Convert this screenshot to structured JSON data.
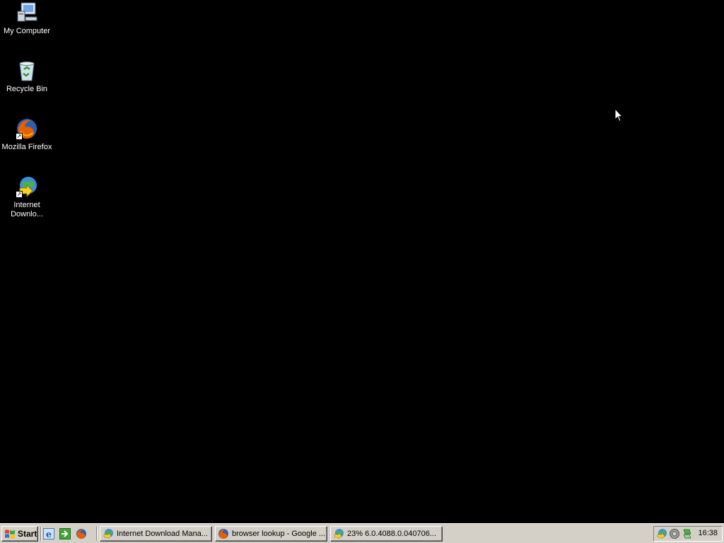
{
  "desktop": {
    "icons": [
      {
        "label": "My Computer",
        "icon": "my-computer-icon"
      },
      {
        "label": "Recycle Bin",
        "icon": "recycle-bin-icon"
      },
      {
        "label": "Mozilla Firefox",
        "icon": "firefox-icon"
      },
      {
        "label": "Internet Downlo...",
        "icon": "internet-download-manager-icon"
      }
    ],
    "background_color": "#000000"
  },
  "taskbar": {
    "start_label": "Start",
    "quick_launch": [
      {
        "icon": "internet-explorer-icon"
      },
      {
        "icon": "show-desktop-icon"
      },
      {
        "icon": "firefox-icon"
      }
    ],
    "tasks": [
      {
        "label": "Internet Download Mana...",
        "icon": "internet-download-manager-icon"
      },
      {
        "label": "browser lookup - Google ...",
        "icon": "firefox-icon"
      },
      {
        "label": "23% 6.0.4088.0.040706...",
        "icon": "internet-download-manager-icon"
      }
    ],
    "tray": {
      "icons": [
        "internet-download-manager-icon",
        "volume-icon",
        "network-icon"
      ],
      "clock": "16:38"
    }
  },
  "colors": {
    "taskbar": "#d4d0c8",
    "desktop": "#000000"
  }
}
